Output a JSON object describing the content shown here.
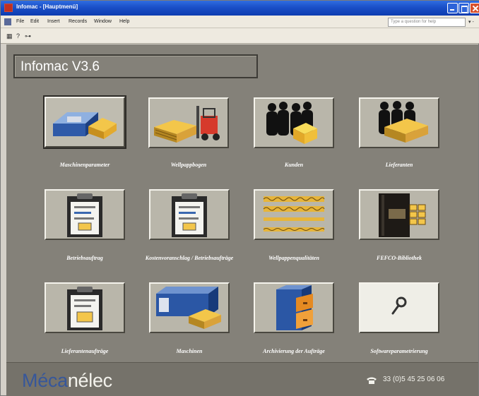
{
  "window": {
    "title": "Infomac - [Hauptmenü]",
    "colors": {
      "title_bar": "#1a4fc7",
      "panel": "#848179",
      "tile": "#b9b6aa",
      "logo_blue": "#37579a"
    }
  },
  "menubar": {
    "items": [
      "File",
      "Edit",
      "Insert",
      "Records",
      "Window",
      "Help"
    ],
    "help_placeholder": "Type a question for help"
  },
  "toolbar": {
    "icons": [
      "design-icon",
      "help-icon",
      "key-icon"
    ]
  },
  "app": {
    "title": "Infomac V3.6"
  },
  "tiles": [
    {
      "label": "Maschinenparameter",
      "icon": "machine-icon"
    },
    {
      "label": "Wellpappbogen",
      "icon": "forklift-icon"
    },
    {
      "label": "Kunden",
      "icon": "customers-icon"
    },
    {
      "label": "Lieferanten",
      "icon": "suppliers-icon"
    },
    {
      "label": "Betriebsauftrag",
      "icon": "clipboard-icon"
    },
    {
      "label": "Kostenvoranschlag / Betriebsaufträge",
      "icon": "clipboard-icon"
    },
    {
      "label": "Wellpappenqualitäten",
      "icon": "corrugated-icon"
    },
    {
      "label": "FEFCO-Bibliothek",
      "icon": "book-icon"
    },
    {
      "label": "Lieferantenaufträge",
      "icon": "clipboard-icon"
    },
    {
      "label": "Maschinen",
      "icon": "machine-icon"
    },
    {
      "label": "Archivierung der Aufträge",
      "icon": "cabinet-icon"
    },
    {
      "label": "Softwareparametrierung",
      "icon": "wrench-icon"
    }
  ],
  "footer": {
    "logo_part1": "Méca",
    "logo_part2": "nélec",
    "phone": "33 (0)5 45 25 06 06"
  }
}
